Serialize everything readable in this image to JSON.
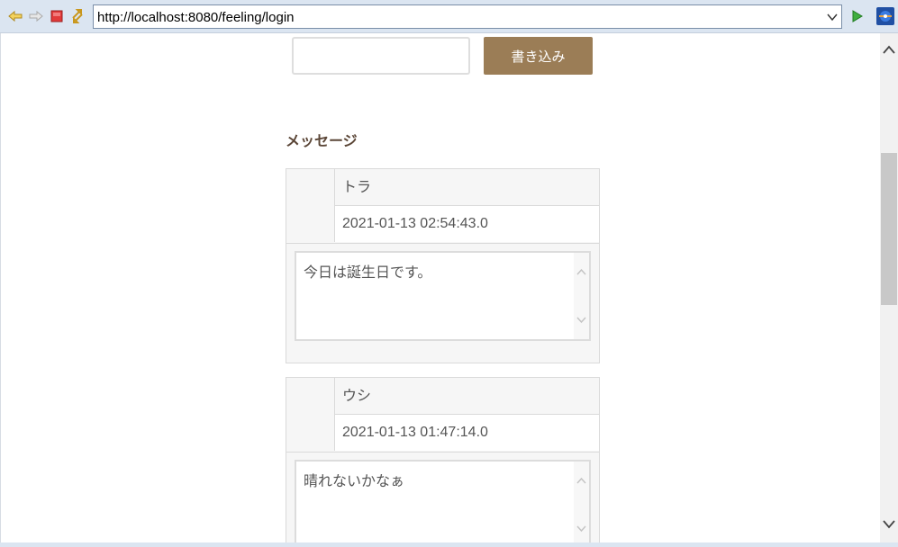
{
  "browser": {
    "url": "http://localhost:8080/feeling/login",
    "buttons": [
      "back-icon",
      "forward-icon",
      "stop-icon",
      "refresh-icon",
      "go-icon",
      "browser-logo-icon"
    ]
  },
  "form": {
    "input_value": "",
    "submit_label": "書き込み"
  },
  "messages": {
    "title": "メッセージ",
    "items": [
      {
        "name": "トラ",
        "date": "2021-01-13 02:54:43.0",
        "text": "今日は誕生日です。"
      },
      {
        "name": "ウシ",
        "date": "2021-01-13 01:47:14.0",
        "text": "晴れないかなぁ"
      }
    ]
  },
  "colors": {
    "accent": "#9b7d56",
    "title": "#5b4637",
    "toolbar": "#dbe5f1"
  }
}
